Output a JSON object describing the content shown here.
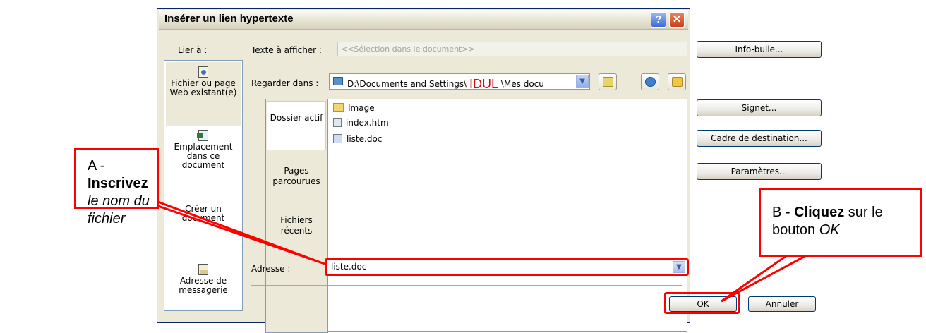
{
  "dialog": {
    "title": "Insérer un lien hypertexte",
    "help_label": "?",
    "close_label": "✕"
  },
  "lier": {
    "label": "Lier à :",
    "items": [
      {
        "label": "Fichier ou page Web existant(e)",
        "icon": "file-web-icon"
      },
      {
        "label": "Emplacement dans ce document",
        "icon": "document-place-icon"
      },
      {
        "label": "Créer un document",
        "icon": "new-document-icon"
      },
      {
        "label": "Adresse de messagerie",
        "icon": "email-address-icon"
      }
    ]
  },
  "texte": {
    "label": "Texte à afficher :",
    "value": "<<Sélection dans le document>>"
  },
  "infobulle": {
    "label": "Info-bulle..."
  },
  "regarder": {
    "label": "Regarder dans :",
    "path_before": "D:\\Documents and Settings\\ ",
    "path_idul": "IDUL",
    "path_after": " \\Mes docu"
  },
  "places": [
    {
      "label": "Dossier actif"
    },
    {
      "label": "Pages parcourues"
    },
    {
      "label": "Fichiers récents"
    }
  ],
  "files": [
    {
      "name": "Image",
      "icon": "folder-icon"
    },
    {
      "name": "index.htm",
      "icon": "html-file-icon"
    },
    {
      "name": "liste.doc",
      "icon": "word-doc-icon"
    }
  ],
  "side_buttons": {
    "signet": "Signet...",
    "cadre": "Cadre de destination...",
    "parametres": "Paramètres..."
  },
  "adresse": {
    "label": "Adresse :",
    "value": "liste.doc"
  },
  "footer": {
    "ok": "OK",
    "annuler": "Annuler"
  },
  "callouts": {
    "a_prefix": "A - ",
    "a_bold": "Inscrivez",
    "a_italic": " le nom du fichier",
    "b_prefix": "B - ",
    "b_bold": "Cliquez",
    "b_mid": " sur le bouton ",
    "b_italic": "OK"
  },
  "colors": {
    "dialog_bg": "#ece9d8",
    "highlight": "#ff0000",
    "idul_text": "#cc1111"
  }
}
